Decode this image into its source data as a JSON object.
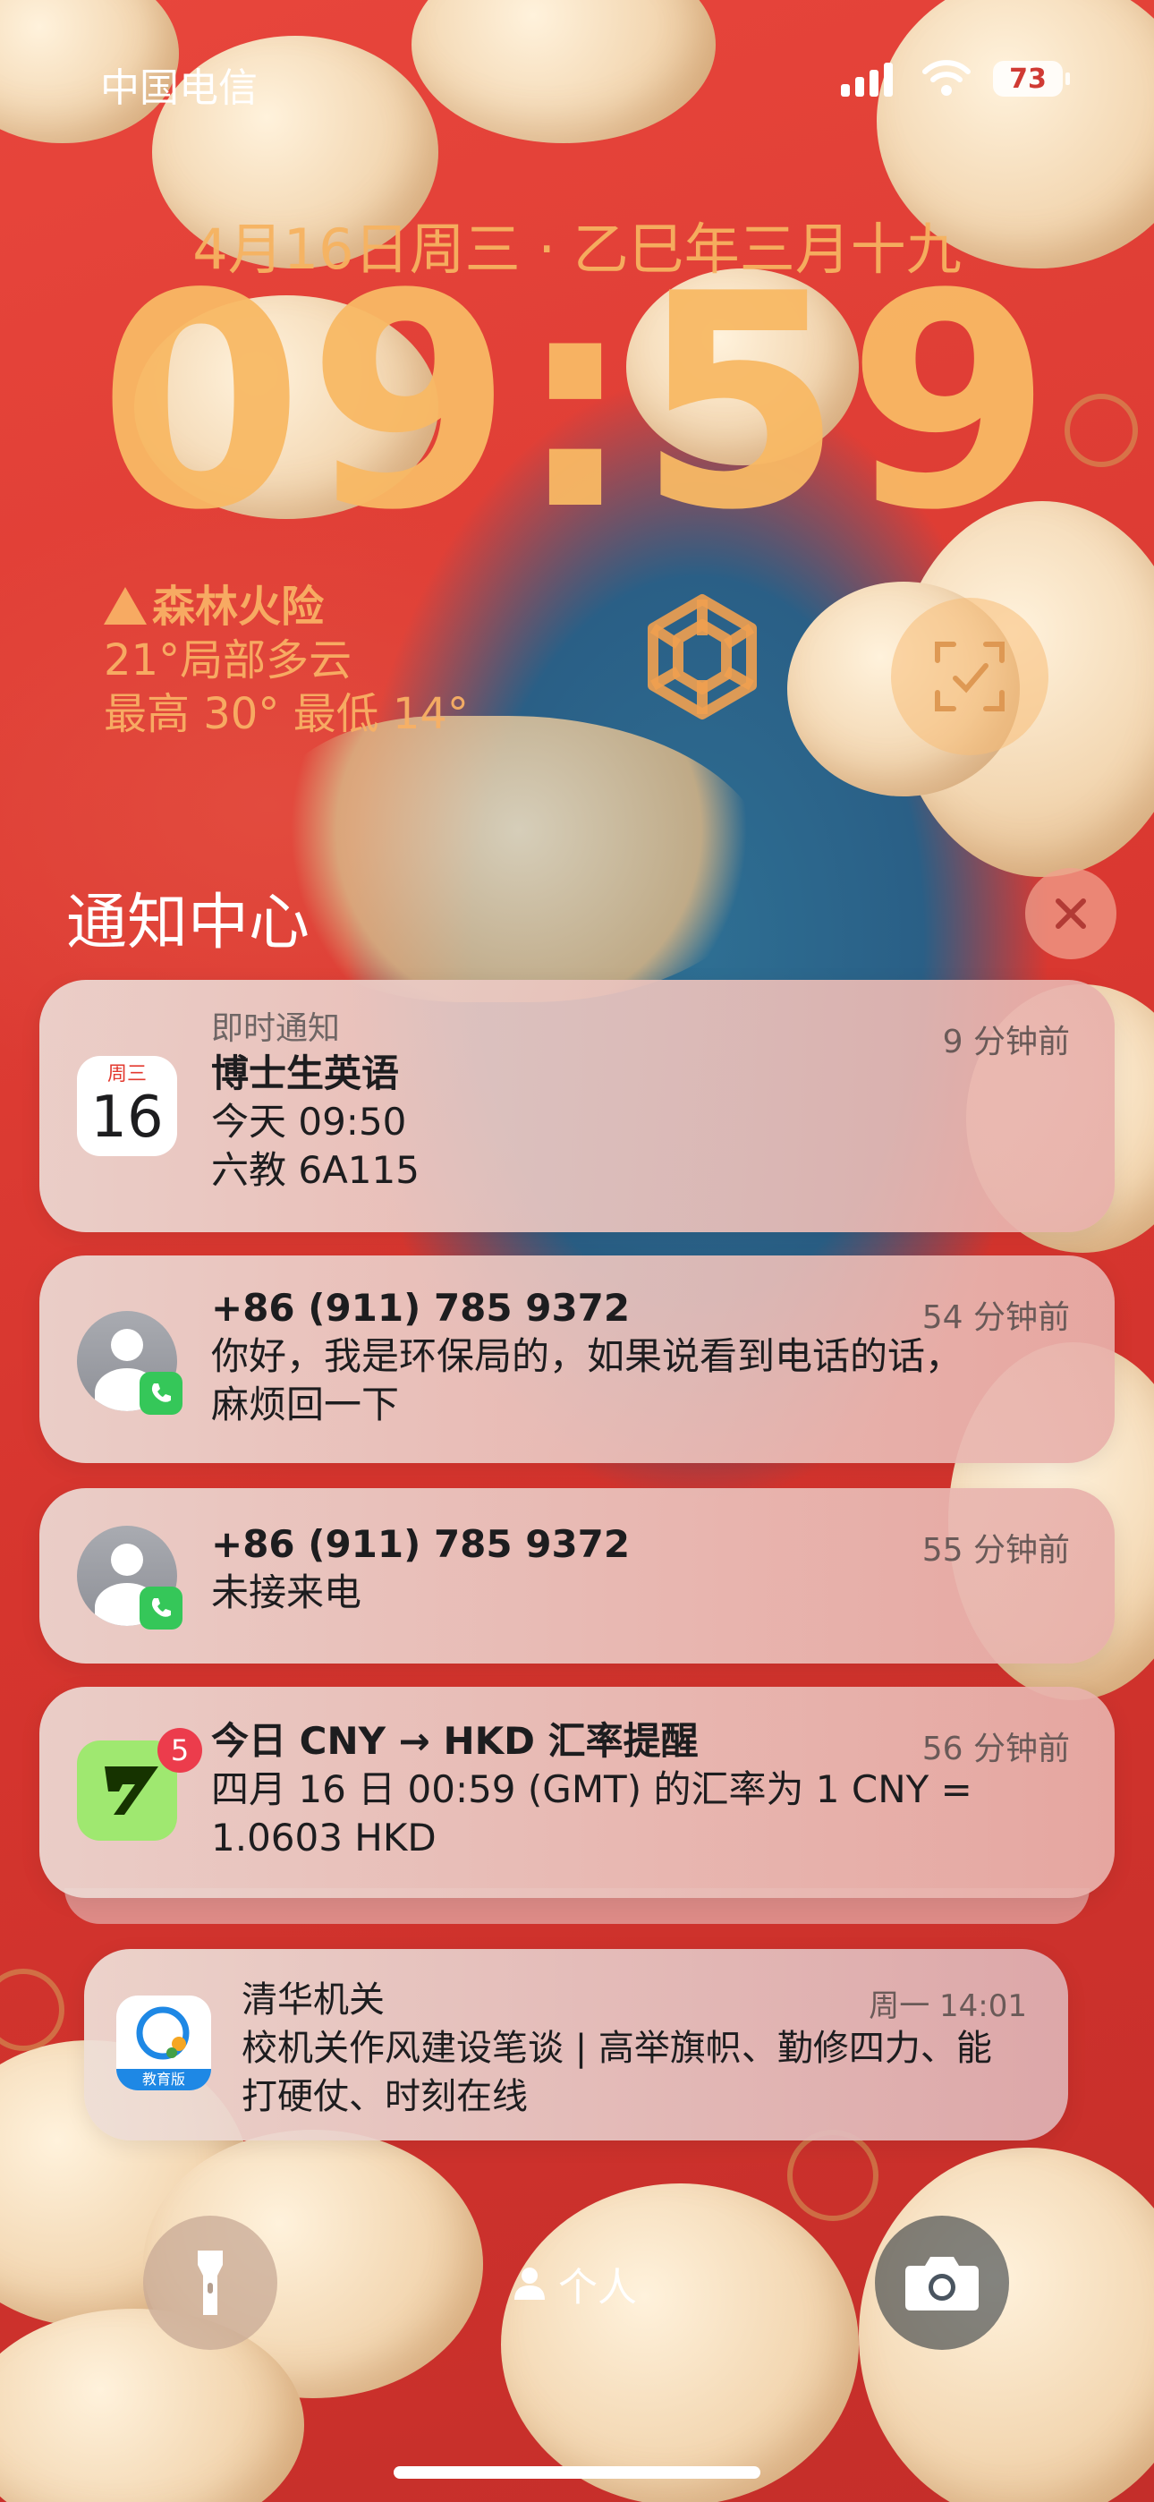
{
  "status_bar": {
    "carrier": "中国电信",
    "battery": "73"
  },
  "lock": {
    "date": "4月16日周三 · 乙巳年三月十九",
    "time": "09:59"
  },
  "weather": {
    "alert": "森林火险",
    "current": "21°局部多云",
    "range": "最高 30° 最低 14°"
  },
  "notification_center": {
    "title": "通知中心"
  },
  "notifications": [
    {
      "app": "即时通知",
      "title": "博士生英语",
      "line1": "今天 09:50",
      "line2": "六教 6A115",
      "time": "9 分钟前",
      "calendar": {
        "weekday": "周三",
        "day": "16"
      }
    },
    {
      "title": "+86 (911) 785 9372",
      "line1": "你好，我是环保局的，如果说看到电话的话，",
      "line2": "麻烦回一下",
      "time": "54 分钟前"
    },
    {
      "title": "+86 (911) 785 9372",
      "line1": "未接来电",
      "time": "55 分钟前"
    },
    {
      "title": "今日 CNY → HKD 汇率提醒",
      "line1": "四月 16 日 00:59 (GMT) 的汇率为 1 CNY =",
      "line2": "1.0603 HKD",
      "time": "56 分钟前",
      "badge": "5"
    },
    {
      "title": "清华机关",
      "line1": "校机关作风建设笔谈 | 高举旗帜、勤修四力、能",
      "line2": "打硬仗、时刻在线",
      "time": "周一 14:01",
      "icon_label": "教育版"
    }
  ],
  "bottom": {
    "focus_label": "个人"
  },
  "colors": {
    "accent_orange": "#f8b864",
    "call_green": "#35c759",
    "badge_red": "#ec3c4c",
    "wise_green": "#9fe870"
  },
  "icons": [
    "signal-icon",
    "wifi-icon",
    "warning-icon",
    "chatgpt-logo-icon",
    "scan-icon",
    "close-icon",
    "calendar-icon",
    "contact-avatar-icon",
    "phone-icon",
    "wise-app-icon",
    "qq-mail-edu-icon",
    "flashlight-icon",
    "person-icon",
    "camera-icon"
  ]
}
